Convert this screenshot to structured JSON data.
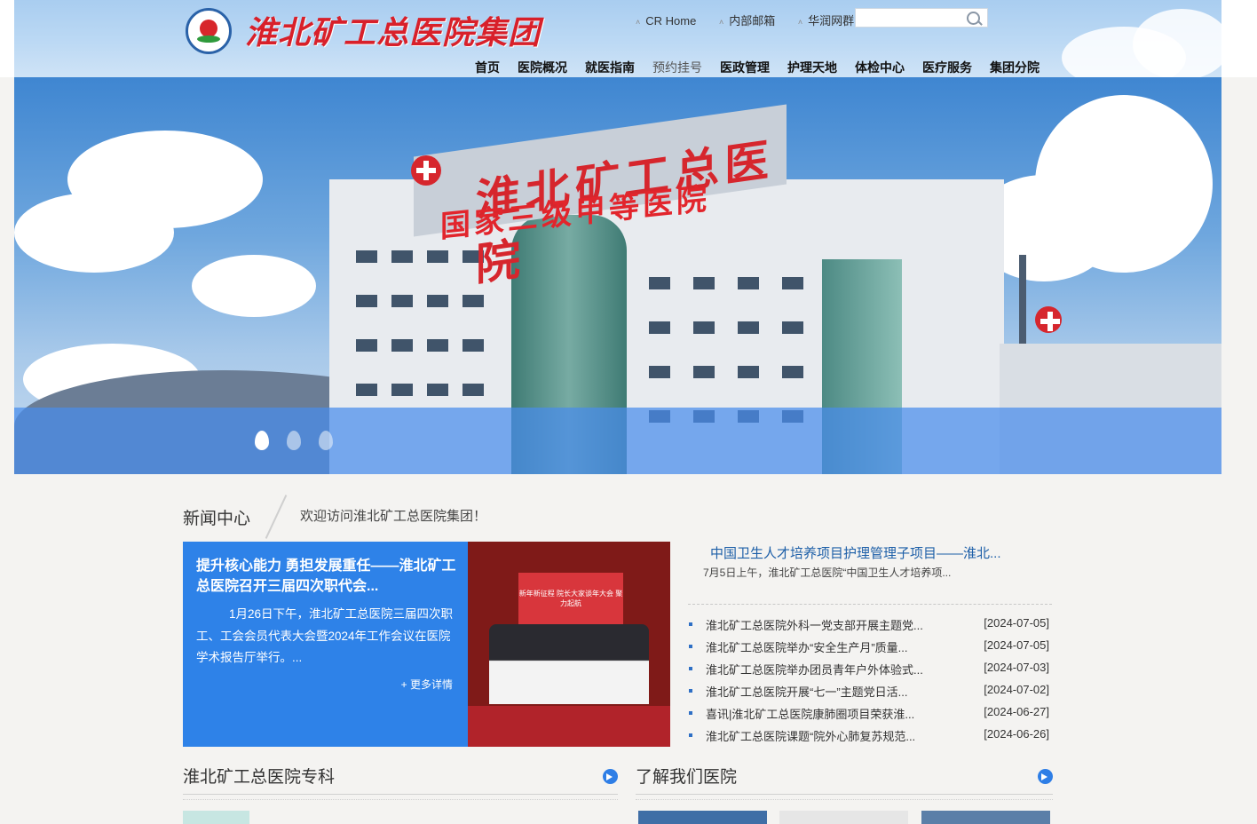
{
  "header": {
    "logo_text": "淮北矿工总医院集团",
    "top_links": [
      "CR Home",
      "内部邮箱",
      "华润网群"
    ],
    "search": {
      "placeholder": "",
      "value": ""
    },
    "nav": [
      "首页",
      "医院概况",
      "就医指南",
      "预约挂号",
      "医政管理",
      "护理天地",
      "体检中心",
      "医疗服务",
      "集团分院"
    ]
  },
  "banner": {
    "sign_top": "淮北矿工总医院",
    "sign_red": "国家三级甲等医院",
    "slides_count": 3,
    "active_slide": 1
  },
  "news": {
    "title": "新闻中心",
    "welcome": "欢迎访问淮北矿工总医院集团！",
    "feature": {
      "title": "提升核心能力 勇担发展重任——淮北矿工总医院召开三届四次职代会...",
      "body": "1月26日下午，淮北矿工总医院三届四次职工、工会会员代表大会暨2024年工作会议在医院学术报告厅举行。...",
      "more": "+ 更多详情",
      "photo_caption": "新年新征程 院长大家谈年大会 聚力起航"
    },
    "headline": {
      "title": "中国卫生人才培养项目护理管理子项目——淮北...",
      "desc": "7月5日上午，淮北矿工总医院“中国卫生人才培养项..."
    },
    "list": [
      {
        "title": "淮北矿工总医院外科一党支部开展主题党...",
        "date": "[2024-07-05]"
      },
      {
        "title": "淮北矿工总医院举办“安全生产月”质量...",
        "date": "[2024-07-05]"
      },
      {
        "title": "淮北矿工总医院举办团员青年户外体验式...",
        "date": "[2024-07-03]"
      },
      {
        "title": "淮北矿工总医院开展“七一”主题党日活...",
        "date": "[2024-07-02]"
      },
      {
        "title": "喜讯|淮北矿工总医院康肺圈项目荣获淮...",
        "date": "[2024-06-27]"
      },
      {
        "title": "淮北矿工总医院课题“院外心肺复苏规范...",
        "date": "[2024-06-26]"
      }
    ]
  },
  "sections": {
    "specialty": "淮北矿工总医院专科",
    "about": "了解我们医院"
  },
  "colors": {
    "accent": "#2e82e8",
    "brand_red": "#d8202a",
    "link_blue": "#1d5fa8"
  }
}
